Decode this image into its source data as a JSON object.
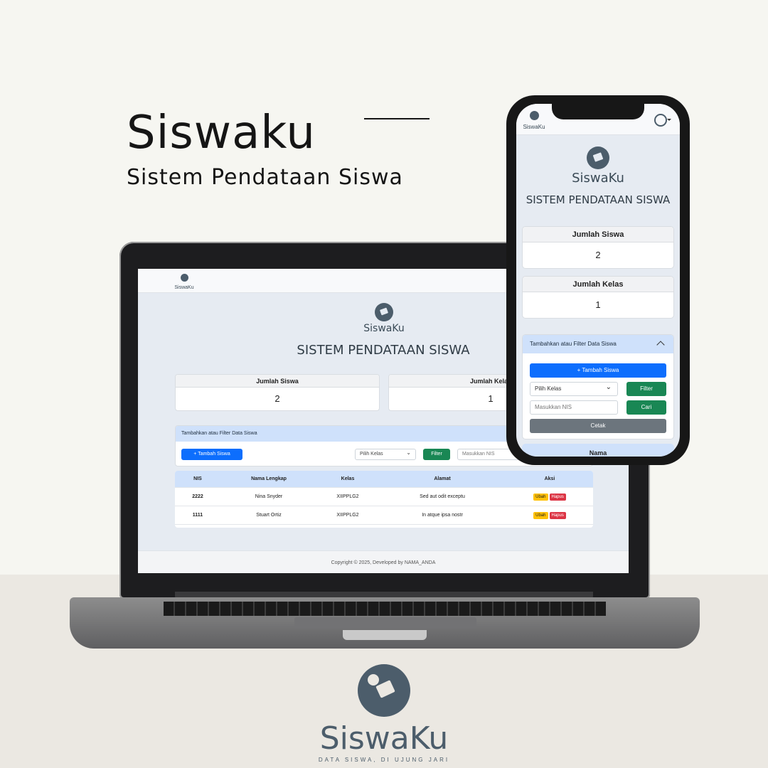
{
  "hero": {
    "title": "Siswaku",
    "subtitle": "Sistem Pendataan Siswa"
  },
  "app": {
    "logo_text": "SiswaKu",
    "heading": "SISTEM PENDATAAN SISWA",
    "cards": {
      "students_label": "Jumlah Siswa",
      "students_value": "2",
      "classes_label": "Jumlah Kelas",
      "classes_value": "1"
    },
    "filter": {
      "title": "Tambahkan atau Filter Data Siswa",
      "add_button": "+ Tambah Siswa",
      "class_select": "Pilih Kelas",
      "filter_button": "Filter",
      "nis_placeholder": "Masukkan NIS",
      "search_button": "Cari",
      "print_button": "Cetak"
    },
    "table": {
      "headers": [
        "NIS",
        "Nama Lengkap",
        "Kelas",
        "Alamat",
        "Aksi"
      ],
      "mobile_header": "Nama",
      "rows": [
        {
          "nis": "2222",
          "name": "Nina Snyder",
          "class": "XIIPPLG2",
          "address": "Sed aut odit exceptu",
          "edit": "Ubah",
          "delete": "Hapus"
        },
        {
          "nis": "1111",
          "name": "Stuart Ortiz",
          "class": "XIIPPLG2",
          "address": "In atque ipsa nostr",
          "edit": "Ubah",
          "delete": "Hapus"
        }
      ]
    },
    "footer": "Copyright © 2025, Developed by NAMA_ANDA"
  },
  "brand": {
    "name": "SiswaKu",
    "tagline": "DATA SISWA, DI UJUNG JARI"
  },
  "colors": {
    "primary": "#0d6efd",
    "success": "#198754",
    "secondary": "#6c757d",
    "warning": "#ffc107",
    "danger": "#dc3545",
    "brand": "#4c5d6b",
    "accent_header": "#cfe1fb"
  }
}
